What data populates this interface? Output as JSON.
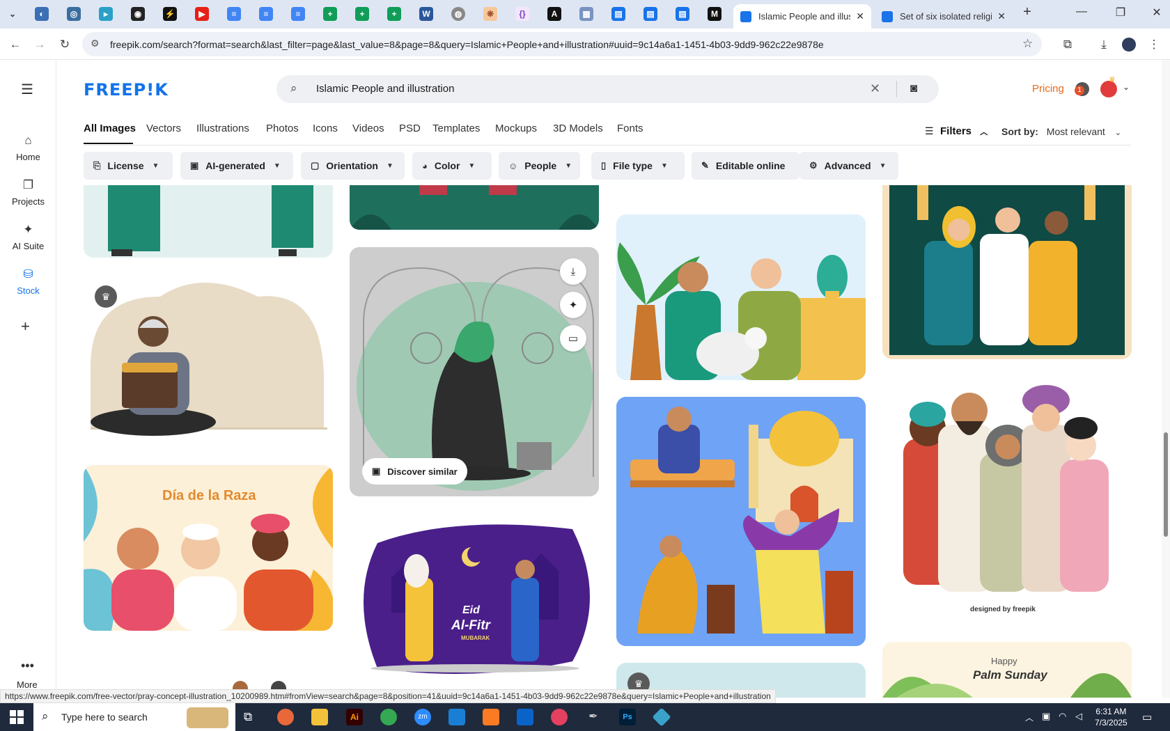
{
  "browser": {
    "tabs": [
      {
        "label": "Islamic People and illustra",
        "active": true
      },
      {
        "label": "Set of six isolated religio",
        "active": false
      }
    ],
    "new_tab_icon": "plus-icon",
    "address": "freepik.com/search?format=search&last_filter=page&last_value=8&page=8&query=Islamic+People+and+illustration#uuid=9c14a6a1-1451-4b03-9dd9-962c22e9878e"
  },
  "sidebar": {
    "items": [
      {
        "label": "Home",
        "icon": "home-icon"
      },
      {
        "label": "Projects",
        "icon": "projects-icon"
      },
      {
        "label": "AI Suite",
        "icon": "sparkle-icon"
      },
      {
        "label": "Stock",
        "icon": "stock-icon"
      }
    ],
    "more_label": "More"
  },
  "header": {
    "logo": "FREEP!K",
    "search_query": "Islamic People and illustration",
    "pricing_label": "Pricing",
    "notification_count": "1"
  },
  "categories": [
    "All Images",
    "Vectors",
    "Illustrations",
    "Photos",
    "Icons",
    "Videos",
    "PSD",
    "Templates",
    "Mockups",
    "3D Models",
    "Fonts"
  ],
  "filters_label": "Filters",
  "sort": {
    "label": "Sort by:",
    "value": "Most relevant"
  },
  "chips": [
    "License",
    "AI-generated",
    "Orientation",
    "Color",
    "People",
    "File type",
    "Editable online",
    "Advanced"
  ],
  "cards": {
    "raza_title": "Día de la Raza",
    "eid_line1": "Eid",
    "eid_line2": "Al-Fitr",
    "eid_line3": "MUBARAK",
    "palm_line1": "Happy",
    "palm_line2": "Palm Sunday",
    "designed_by": "designed by freepik",
    "discover_label": "Discover similar"
  },
  "status_url": "https://www.freepik.com/free-vector/pray-concept-illustration_10200989.htm#fromView=search&page=8&position=41&uuid=9c14a6a1-1451-4b03-9dd9-962c22e9878e&query=Islamic+People+and+illustration",
  "taskbar": {
    "search_placeholder": "Type here to search",
    "time": "6:31 AM",
    "date": "7/3/2025"
  }
}
